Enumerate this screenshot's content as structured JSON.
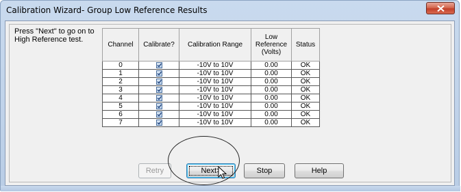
{
  "window": {
    "title": "Calibration Wizard- Group Low Reference Results"
  },
  "instructions": "Press \"Next\" to go on to High Reference test.",
  "table": {
    "headers": [
      "Channel",
      "Calibrate?",
      "Calibration Range",
      "Low Reference (Volts)",
      "Status"
    ],
    "rows": [
      {
        "channel": "0",
        "calibrate": true,
        "range": "-10V to 10V",
        "low_ref": "0.00",
        "status": "OK"
      },
      {
        "channel": "1",
        "calibrate": true,
        "range": "-10V to 10V",
        "low_ref": "0.00",
        "status": "OK"
      },
      {
        "channel": "2",
        "calibrate": true,
        "range": "-10V to 10V",
        "low_ref": "0.00",
        "status": "OK"
      },
      {
        "channel": "3",
        "calibrate": true,
        "range": "-10V to 10V",
        "low_ref": "0.00",
        "status": "OK"
      },
      {
        "channel": "4",
        "calibrate": true,
        "range": "-10V to 10V",
        "low_ref": "0.00",
        "status": "OK"
      },
      {
        "channel": "5",
        "calibrate": true,
        "range": "-10V to 10V",
        "low_ref": "0.00",
        "status": "OK"
      },
      {
        "channel": "6",
        "calibrate": true,
        "range": "-10V to 10V",
        "low_ref": "0.00",
        "status": "OK"
      },
      {
        "channel": "7",
        "calibrate": true,
        "range": "-10V to 10V",
        "low_ref": "0.00",
        "status": "OK"
      }
    ]
  },
  "buttons": {
    "retry": "Retry",
    "next": "Next>",
    "stop": "Stop",
    "help": "Help"
  },
  "icons": {
    "close": "close-icon",
    "checkbox": "checkmark-icon",
    "cursor": "mouse-pointer-icon"
  },
  "colors": {
    "close_button": "#c2402a",
    "title_bar": "#c9daee",
    "default_button_border": "#3c7fb1"
  }
}
